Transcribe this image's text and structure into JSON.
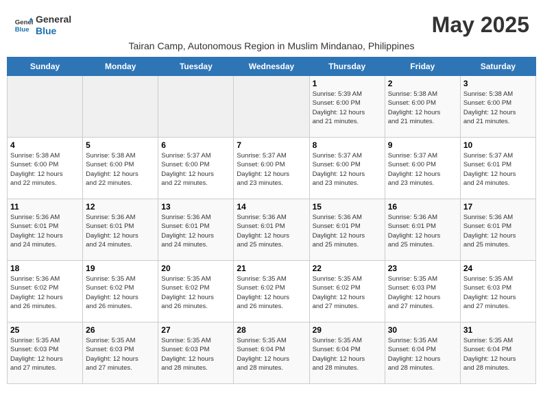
{
  "header": {
    "logo_line1": "General",
    "logo_line2": "Blue",
    "month_title": "May 2025",
    "subtitle": "Tairan Camp, Autonomous Region in Muslim Mindanao, Philippines"
  },
  "weekdays": [
    "Sunday",
    "Monday",
    "Tuesday",
    "Wednesday",
    "Thursday",
    "Friday",
    "Saturday"
  ],
  "weeks": [
    [
      {
        "day": "",
        "info": ""
      },
      {
        "day": "",
        "info": ""
      },
      {
        "day": "",
        "info": ""
      },
      {
        "day": "",
        "info": ""
      },
      {
        "day": "1",
        "info": "Sunrise: 5:39 AM\nSunset: 6:00 PM\nDaylight: 12 hours\nand 21 minutes."
      },
      {
        "day": "2",
        "info": "Sunrise: 5:38 AM\nSunset: 6:00 PM\nDaylight: 12 hours\nand 21 minutes."
      },
      {
        "day": "3",
        "info": "Sunrise: 5:38 AM\nSunset: 6:00 PM\nDaylight: 12 hours\nand 21 minutes."
      }
    ],
    [
      {
        "day": "4",
        "info": "Sunrise: 5:38 AM\nSunset: 6:00 PM\nDaylight: 12 hours\nand 22 minutes."
      },
      {
        "day": "5",
        "info": "Sunrise: 5:38 AM\nSunset: 6:00 PM\nDaylight: 12 hours\nand 22 minutes."
      },
      {
        "day": "6",
        "info": "Sunrise: 5:37 AM\nSunset: 6:00 PM\nDaylight: 12 hours\nand 22 minutes."
      },
      {
        "day": "7",
        "info": "Sunrise: 5:37 AM\nSunset: 6:00 PM\nDaylight: 12 hours\nand 23 minutes."
      },
      {
        "day": "8",
        "info": "Sunrise: 5:37 AM\nSunset: 6:00 PM\nDaylight: 12 hours\nand 23 minutes."
      },
      {
        "day": "9",
        "info": "Sunrise: 5:37 AM\nSunset: 6:00 PM\nDaylight: 12 hours\nand 23 minutes."
      },
      {
        "day": "10",
        "info": "Sunrise: 5:37 AM\nSunset: 6:01 PM\nDaylight: 12 hours\nand 24 minutes."
      }
    ],
    [
      {
        "day": "11",
        "info": "Sunrise: 5:36 AM\nSunset: 6:01 PM\nDaylight: 12 hours\nand 24 minutes."
      },
      {
        "day": "12",
        "info": "Sunrise: 5:36 AM\nSunset: 6:01 PM\nDaylight: 12 hours\nand 24 minutes."
      },
      {
        "day": "13",
        "info": "Sunrise: 5:36 AM\nSunset: 6:01 PM\nDaylight: 12 hours\nand 24 minutes."
      },
      {
        "day": "14",
        "info": "Sunrise: 5:36 AM\nSunset: 6:01 PM\nDaylight: 12 hours\nand 25 minutes."
      },
      {
        "day": "15",
        "info": "Sunrise: 5:36 AM\nSunset: 6:01 PM\nDaylight: 12 hours\nand 25 minutes."
      },
      {
        "day": "16",
        "info": "Sunrise: 5:36 AM\nSunset: 6:01 PM\nDaylight: 12 hours\nand 25 minutes."
      },
      {
        "day": "17",
        "info": "Sunrise: 5:36 AM\nSunset: 6:01 PM\nDaylight: 12 hours\nand 25 minutes."
      }
    ],
    [
      {
        "day": "18",
        "info": "Sunrise: 5:36 AM\nSunset: 6:02 PM\nDaylight: 12 hours\nand 26 minutes."
      },
      {
        "day": "19",
        "info": "Sunrise: 5:35 AM\nSunset: 6:02 PM\nDaylight: 12 hours\nand 26 minutes."
      },
      {
        "day": "20",
        "info": "Sunrise: 5:35 AM\nSunset: 6:02 PM\nDaylight: 12 hours\nand 26 minutes."
      },
      {
        "day": "21",
        "info": "Sunrise: 5:35 AM\nSunset: 6:02 PM\nDaylight: 12 hours\nand 26 minutes."
      },
      {
        "day": "22",
        "info": "Sunrise: 5:35 AM\nSunset: 6:02 PM\nDaylight: 12 hours\nand 27 minutes."
      },
      {
        "day": "23",
        "info": "Sunrise: 5:35 AM\nSunset: 6:03 PM\nDaylight: 12 hours\nand 27 minutes."
      },
      {
        "day": "24",
        "info": "Sunrise: 5:35 AM\nSunset: 6:03 PM\nDaylight: 12 hours\nand 27 minutes."
      }
    ],
    [
      {
        "day": "25",
        "info": "Sunrise: 5:35 AM\nSunset: 6:03 PM\nDaylight: 12 hours\nand 27 minutes."
      },
      {
        "day": "26",
        "info": "Sunrise: 5:35 AM\nSunset: 6:03 PM\nDaylight: 12 hours\nand 27 minutes."
      },
      {
        "day": "27",
        "info": "Sunrise: 5:35 AM\nSunset: 6:03 PM\nDaylight: 12 hours\nand 28 minutes."
      },
      {
        "day": "28",
        "info": "Sunrise: 5:35 AM\nSunset: 6:04 PM\nDaylight: 12 hours\nand 28 minutes."
      },
      {
        "day": "29",
        "info": "Sunrise: 5:35 AM\nSunset: 6:04 PM\nDaylight: 12 hours\nand 28 minutes."
      },
      {
        "day": "30",
        "info": "Sunrise: 5:35 AM\nSunset: 6:04 PM\nDaylight: 12 hours\nand 28 minutes."
      },
      {
        "day": "31",
        "info": "Sunrise: 5:35 AM\nSunset: 6:04 PM\nDaylight: 12 hours\nand 28 minutes."
      }
    ]
  ]
}
